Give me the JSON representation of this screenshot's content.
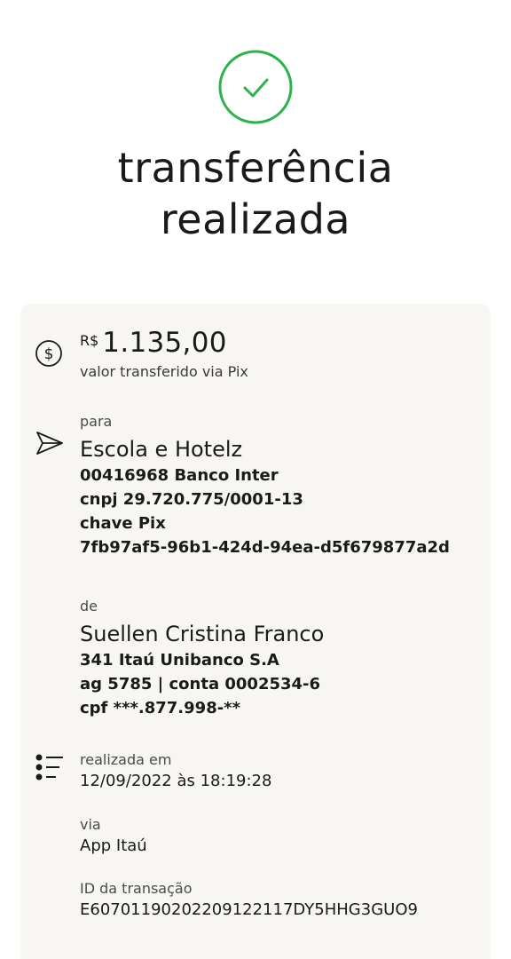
{
  "header": {
    "title_line1": "transferência",
    "title_line2": "realizada",
    "status_color": "#2db34a"
  },
  "amount": {
    "currency": "R$",
    "value": "1.135,00",
    "caption": "valor transferido via Pix"
  },
  "recipient": {
    "label": "para",
    "name": "Escola e Hotelz",
    "bank": "00416968 Banco Inter",
    "document": "cnpj 29.720.775/0001-13",
    "key_label": "chave Pix",
    "key": "7fb97af5-96b1-424d-94ea-d5f679877a2d"
  },
  "sender": {
    "label": "de",
    "name": "Suellen Cristina Franco",
    "bank": "341 Itaú Unibanco S.A",
    "account": "ag 5785 | conta 0002534-6",
    "document": "cpf ***.877.998-**"
  },
  "details": {
    "date_label": "realizada em",
    "date": "12/09/2022 às 18:19:28",
    "via_label": "via",
    "via": "App Itaú",
    "id_label": "ID da transação",
    "id": "E60701190202209122117DY5HHG3GUO9"
  },
  "icons": {
    "status": "check-circle-icon",
    "amount": "dollar-circle-icon",
    "recipient": "send-icon",
    "details": "list-icon"
  }
}
